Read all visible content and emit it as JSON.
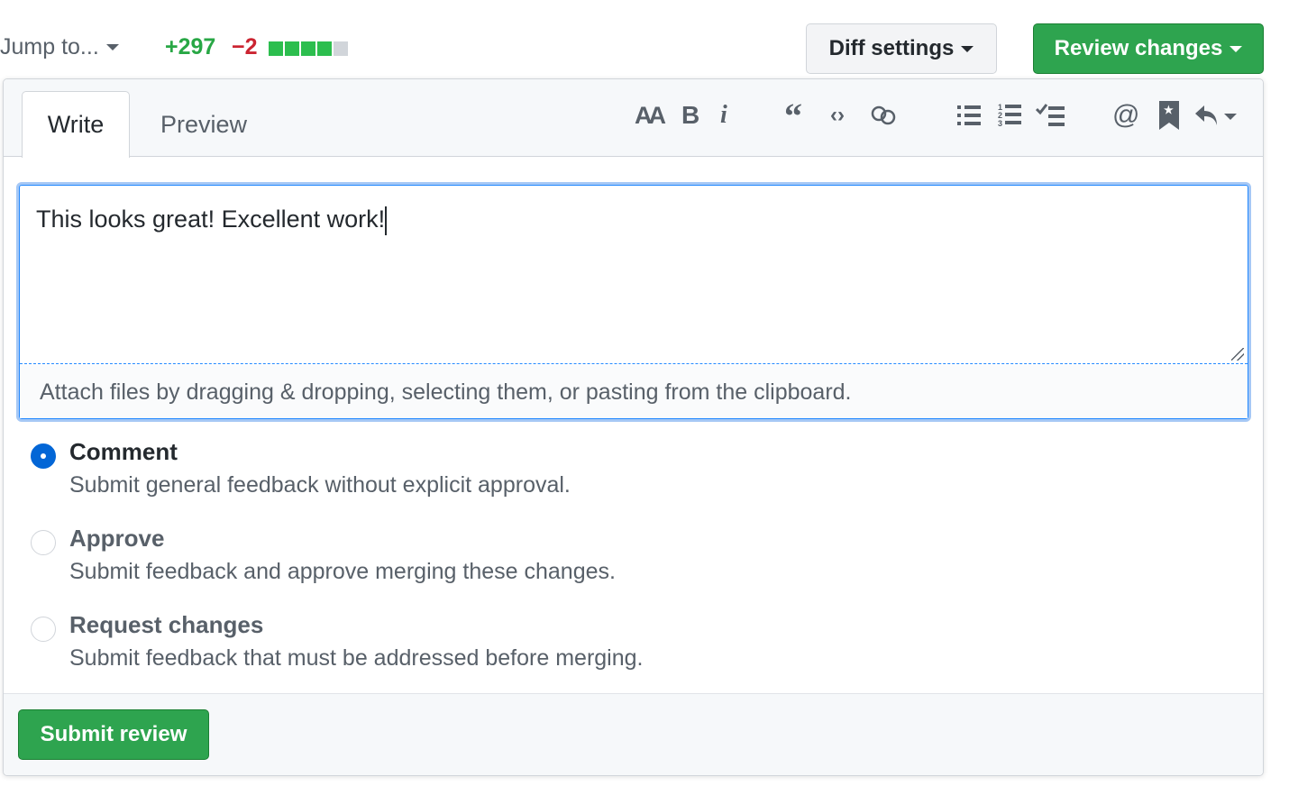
{
  "header": {
    "jump_label": "Jump to...",
    "additions": "+297",
    "deletions": "−2",
    "diffstat_blocks": [
      "added",
      "added",
      "added",
      "added",
      "neutral"
    ],
    "diff_settings_label": "Diff settings",
    "review_changes_label": "Review changes"
  },
  "editor": {
    "tabs": [
      {
        "label": "Write",
        "active": true
      },
      {
        "label": "Preview",
        "active": false
      }
    ],
    "toolbar": [
      {
        "icon": "text-size-icon",
        "glyph": "AA"
      },
      {
        "icon": "bold-icon",
        "glyph": "B"
      },
      {
        "icon": "italic-icon",
        "glyph": "i"
      },
      {
        "icon": "quote-icon",
        "glyph": "❝"
      },
      {
        "icon": "code-icon",
        "glyph": "‹›"
      },
      {
        "icon": "link-icon",
        "glyph": "🔗"
      },
      {
        "icon": "unordered-list-icon",
        "glyph": "☰"
      },
      {
        "icon": "ordered-list-icon",
        "glyph": "☰"
      },
      {
        "icon": "task-list-icon",
        "glyph": "☑"
      },
      {
        "icon": "mention-icon",
        "glyph": "@"
      },
      {
        "icon": "bookmark-icon",
        "glyph": "★"
      },
      {
        "icon": "reply-icon",
        "glyph": "↩"
      }
    ],
    "value": "This looks great! Excellent work!",
    "attach_hint": "Attach files by dragging & dropping, selecting them, or pasting from the clipboard."
  },
  "options": [
    {
      "title": "Comment",
      "desc": "Submit general feedback without explicit approval.",
      "selected": true
    },
    {
      "title": "Approve",
      "desc": "Submit feedback and approve merging these changes.",
      "selected": false
    },
    {
      "title": "Request changes",
      "desc": "Submit feedback that must be addressed before merging.",
      "selected": false
    }
  ],
  "submit_label": "Submit review",
  "colors": {
    "primary": "#2ea44f",
    "focus": "#2188ff",
    "additions": "#28a745",
    "deletions": "#cb2431"
  }
}
